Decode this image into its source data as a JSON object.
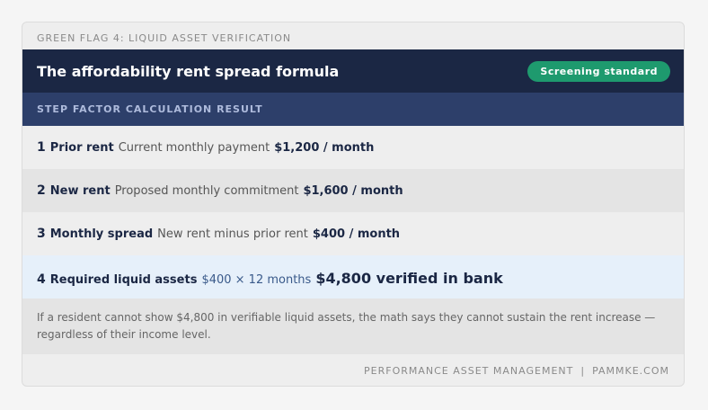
{
  "eyebrow": "GREEN FLAG 4: LIQUID ASSET VERIFICATION",
  "header": {
    "title": "The affordability rent spread formula",
    "badge": "Screening standard"
  },
  "column_header": "STEP FACTOR CALCULATION RESULT",
  "rows": [
    {
      "step": "1",
      "factor": "Prior rent",
      "calc": "Current monthly payment",
      "result": "$1,200 / month"
    },
    {
      "step": "2",
      "factor": "New rent",
      "calc": "Proposed monthly commitment",
      "result": "$1,600 / month"
    },
    {
      "step": "3",
      "factor": "Monthly spread",
      "calc": "New rent minus prior rent",
      "result": "$400 / month"
    },
    {
      "step": "4",
      "factor": "Required liquid assets",
      "calc": "$400 × 12 months",
      "result": "$4,800 verified in bank"
    }
  ],
  "note": "If a resident cannot show $4,800 in verifiable liquid assets, the math says they cannot sustain the rent increase — regardless of their income level.",
  "footer": {
    "company": "PERFORMANCE ASSET MANAGEMENT",
    "separator": "|",
    "site": "PAMMKE.COM"
  },
  "colors": {
    "header_bg": "#1b2744",
    "column_header_bg": "#2d3f6a",
    "badge_bg": "#1e9a6e",
    "highlight_row_bg": "#e6f0fa"
  }
}
